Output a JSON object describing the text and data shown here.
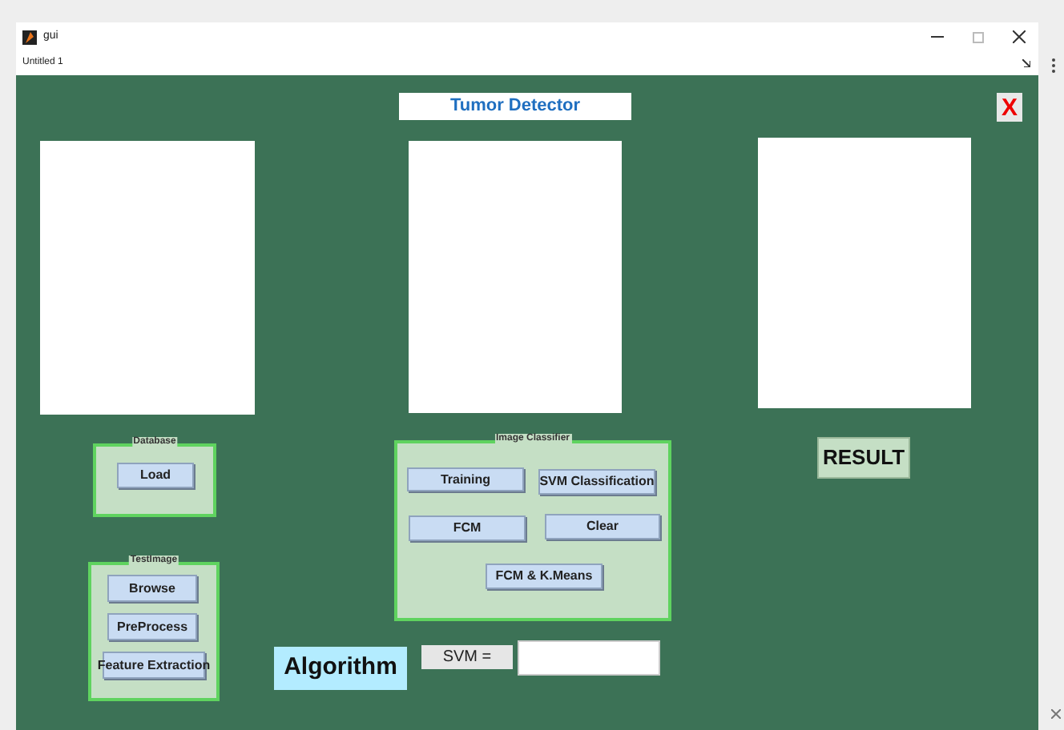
{
  "window": {
    "title": "gui",
    "document_tab": "Untitled 1"
  },
  "header": {
    "title": "Tumor Detector",
    "close_label": "X"
  },
  "database_panel": {
    "title": "Database",
    "buttons": [
      "Load"
    ]
  },
  "test_image_panel": {
    "title": "TestImage",
    "buttons": [
      "Browse",
      "PreProcess",
      "Feature Extraction"
    ]
  },
  "image_classifier_panel": {
    "title": "Image Classifier",
    "buttons": [
      "Training",
      "SVM Classification",
      "FCM",
      "Clear",
      "FCM & K.Means"
    ]
  },
  "algorithm_label": "Algorithm",
  "svm_label": "SVM =",
  "result_label": "RESULT"
}
